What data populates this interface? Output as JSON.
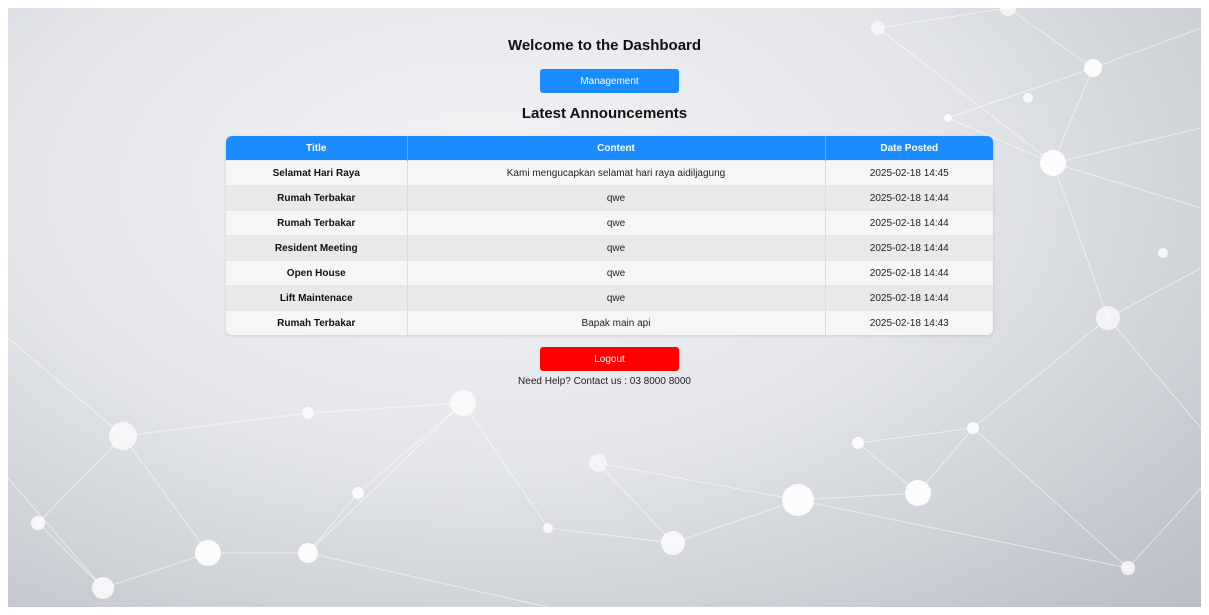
{
  "header": {
    "title": "Welcome to the Dashboard",
    "management_label": "Management"
  },
  "announcements": {
    "heading": "Latest Announcements",
    "columns": [
      "Title",
      "Content",
      "Date Posted"
    ],
    "rows": [
      [
        "Selamat Hari Raya",
        "Kami mengucapkan selamat hari raya aidiljagung",
        "2025-02-18 14:45"
      ],
      [
        "Rumah Terbakar",
        "qwe",
        "2025-02-18 14:44"
      ],
      [
        "Rumah Terbakar",
        "qwe",
        "2025-02-18 14:44"
      ],
      [
        "Resident Meeting",
        "qwe",
        "2025-02-18 14:44"
      ],
      [
        "Open House",
        "qwe",
        "2025-02-18 14:44"
      ],
      [
        "Lift Maintenace",
        "qwe",
        "2025-02-18 14:44"
      ],
      [
        "Rumah Terbakar",
        "Bapak main api",
        "2025-02-18 14:43"
      ]
    ]
  },
  "footer": {
    "logout_label": "Logout",
    "help_text": "Need Help? Contact us : 03 8000 8000"
  },
  "colors": {
    "primary": "#1a8cff",
    "danger": "#ff0000"
  }
}
